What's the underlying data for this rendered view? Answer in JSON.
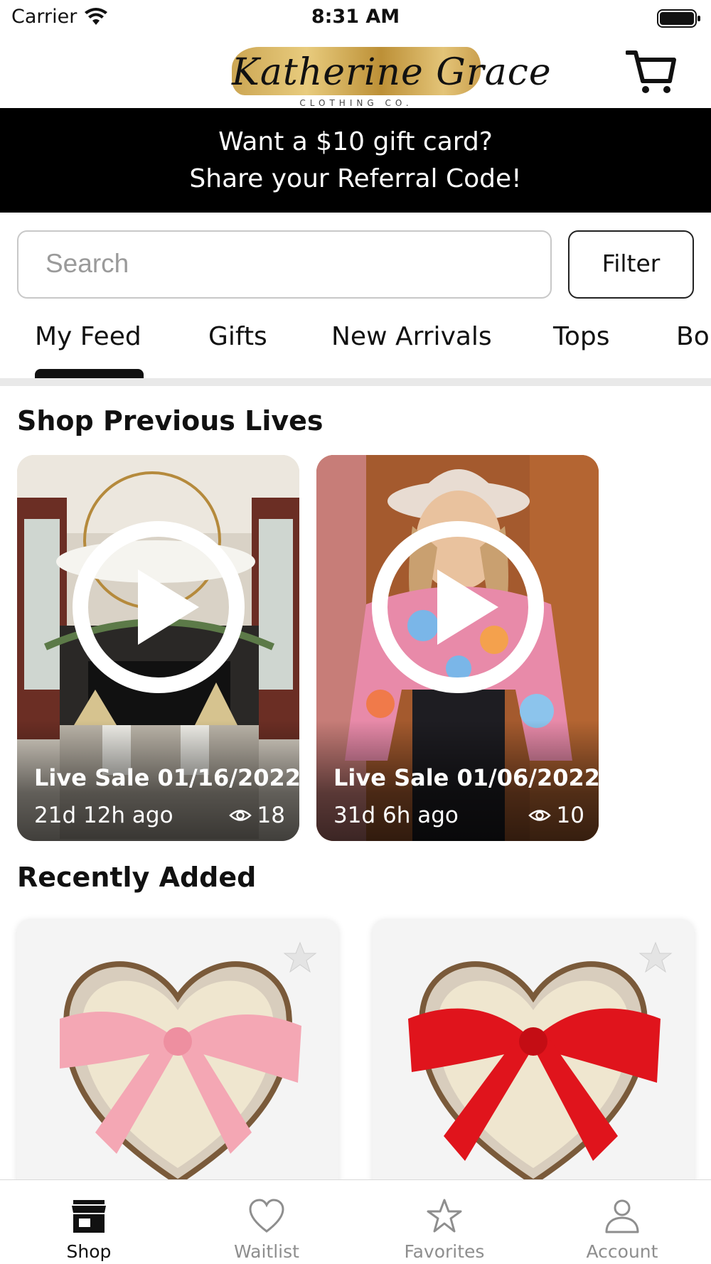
{
  "status_bar": {
    "carrier": "Carrier",
    "time": "8:31 AM"
  },
  "header": {
    "logo_script": "Katherine Grace",
    "logo_sub": "CLOTHING CO."
  },
  "promo": {
    "line1": "Want a $10 gift card?",
    "line2": "Share your Referral Code!"
  },
  "search": {
    "placeholder": "Search",
    "filter_label": "Filter"
  },
  "categories": {
    "active": "My Feed",
    "items": [
      "My Feed",
      "Gifts",
      "New Arrivals",
      "Tops",
      "Bo"
    ]
  },
  "previous_lives": {
    "title": "Shop Previous Lives",
    "items": [
      {
        "title": "Live Sale 01/16/2022",
        "ago": "21d 12h ago",
        "views": "18"
      },
      {
        "title": "Live Sale 01/06/2022",
        "ago": "31d 6h ago",
        "views": "10"
      }
    ]
  },
  "recently_added": {
    "title": "Recently Added",
    "items": [
      {
        "ribbon_color": "#f4a7b4"
      },
      {
        "ribbon_color": "#e0141c"
      }
    ]
  },
  "tabbar": {
    "active": "Shop",
    "items": [
      {
        "label": "Shop",
        "icon": "storefront-icon"
      },
      {
        "label": "Waitlist",
        "icon": "heart-icon"
      },
      {
        "label": "Favorites",
        "icon": "star-icon"
      },
      {
        "label": "Account",
        "icon": "person-icon"
      }
    ]
  }
}
